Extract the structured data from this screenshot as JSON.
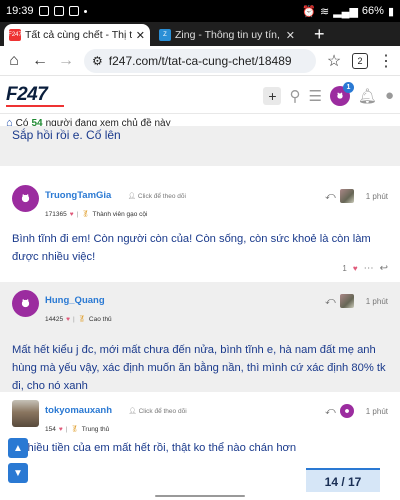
{
  "status_bar": {
    "time": "19:39",
    "battery": "66%"
  },
  "tabs": [
    {
      "title": "Tất cả cùng chết - Thị trườ",
      "favicon": "F247"
    },
    {
      "title": "Zing - Thông tin uy tín, hìn",
      "favicon": "Z"
    }
  ],
  "address_bar": {
    "url": "f247.com/t/tat-ca-cung-chet/18489",
    "tab_count": "2"
  },
  "site": {
    "logo": "F247",
    "notification_count": "1"
  },
  "viewers": {
    "prefix": "Có",
    "count": "54",
    "suffix": "người đang xem chủ đề này"
  },
  "cut_post": {
    "text": "Sắp hồi rồi e. Cố lên"
  },
  "posts": [
    {
      "username": "TruongTamGia",
      "follow_label": "Click để theo dõi",
      "score": "171365",
      "badge": "Thành viên gạo cội",
      "time": "1 phút",
      "body": "Bình tĩnh đi em! Còn người còn của! Còn sống, còn sức khoẻ là còn làm được nhiều việc!",
      "likes": "1"
    },
    {
      "username": "Hung_Quang",
      "score": "14425",
      "badge": "Cao thủ",
      "time": "1 phút",
      "body": "Mất hết kiểu j đc, mới mất chưa đến nửa, bình tĩnh e, hà nam đất mẹ anh hùng mà yếu vậy, xác định muốn ăn bằng nần, thì mình cứ xác định 80% tk đi, cho nó xanh"
    },
    {
      "username": "tokyomauxanh",
      "follow_label": "Click để theo dõi",
      "score": "154",
      "badge": "Trung thủ",
      "time": "1 phút",
      "body": "ế nhiều tiền của em mất hết rồi, thật ko thể nào chán hơn"
    }
  ],
  "topic_progress": {
    "text": "14 / 17",
    "current": 14,
    "total": 17
  },
  "colors": {
    "accent": "#2a79d3",
    "post_text": "#1a3a8c",
    "brand_red": "#e33333"
  },
  "icons": {
    "search": "search-icon",
    "menu": "hamburger-icon",
    "bell": "bell-icon",
    "reply": "reply-icon",
    "heart": "heart-icon",
    "more": "more-icon",
    "scroll_up": "chevron-up-icon",
    "scroll_down": "chevron-down-icon"
  }
}
